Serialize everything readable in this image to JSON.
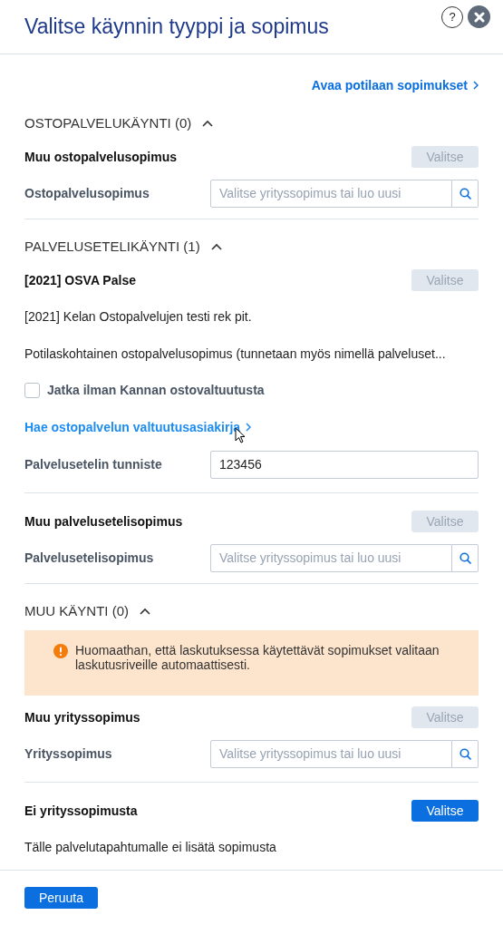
{
  "dialog": {
    "title": "Valitse käynnin tyyppi ja sopimus",
    "help_button": "?"
  },
  "top_link": "Avaa potilaan sopimukset",
  "sections": [
    {
      "heading": "OSTOPALVELUKÄYNTI (0)",
      "expanded": true,
      "rows": [
        {
          "kind": "option",
          "title": "Muu ostopalvelusopimus",
          "button": "Valitse",
          "disabled": true
        },
        {
          "kind": "field",
          "label": "Ostopalvelusopimus",
          "placeholder": "Valitse yrityssopimus tai luo uusi",
          "search": true
        }
      ]
    },
    {
      "heading": "PALVELUSETELIKÄYNTI (1)",
      "expanded": true,
      "rows": [
        {
          "kind": "option",
          "title": "[2021] OSVA Palse",
          "button": "Valitse",
          "disabled": true
        },
        {
          "kind": "text",
          "text": "[2021] Kelan Ostopalvelujen testi rek pit."
        },
        {
          "kind": "text",
          "text": "Potilaskohtainen ostopalvelusopimus (tunnetaan myös nimellä palveluset..."
        },
        {
          "kind": "checkbox",
          "label": "Jatka ilman Kannan ostovaltuutusta",
          "checked": false
        },
        {
          "kind": "link",
          "text": "Hae ostopalvelun valtuutusasiakirja"
        },
        {
          "kind": "field",
          "label": "Palvelusetelin tunniste",
          "value": "123456",
          "search": false
        },
        {
          "kind": "divider"
        },
        {
          "kind": "option",
          "title": "Muu palvelusetelisopimus",
          "button": "Valitse",
          "disabled": true
        },
        {
          "kind": "field",
          "label": "Palvelusetelisopimus",
          "placeholder": "Valitse yrityssopimus tai luo uusi",
          "search": true
        }
      ]
    },
    {
      "heading": "MUU KÄYNTI (0)",
      "expanded": true,
      "rows": [
        {
          "kind": "notice",
          "text": "Huomaathan, että laskutuksessa käytettävät sopimukset valitaan laskutusriveille automaattisesti."
        },
        {
          "kind": "option",
          "title": "Muu yrityssopimus",
          "button": "Valitse",
          "disabled": true
        },
        {
          "kind": "field",
          "label": "Yrityssopimus",
          "placeholder": "Valitse yrityssopimus tai luo uusi",
          "search": true
        },
        {
          "kind": "divider"
        },
        {
          "kind": "option",
          "title": "Ei yrityssopimusta",
          "button": "Valitse",
          "disabled": false
        },
        {
          "kind": "text",
          "text": "Tälle palvelutapahtumalle ei lisätä sopimusta"
        }
      ]
    }
  ],
  "footer": {
    "cancel_button": "Peruuta"
  }
}
